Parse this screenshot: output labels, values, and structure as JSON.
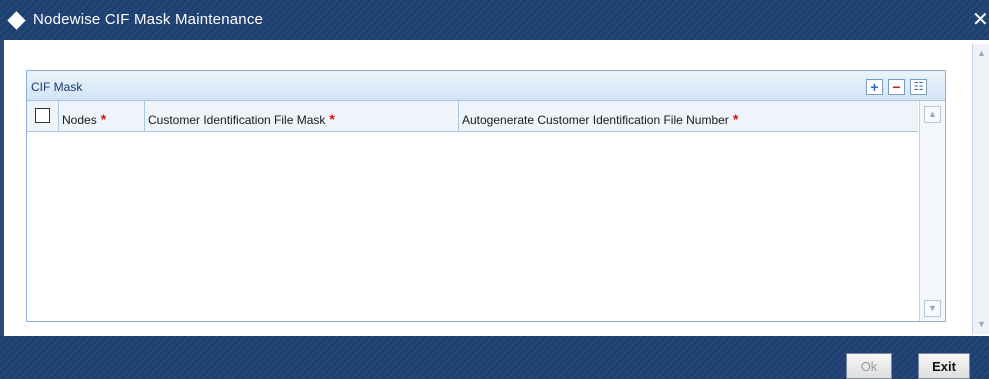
{
  "window": {
    "title": "Nodewise CIF Mask Maintenance",
    "close_glyph": "✕"
  },
  "panel": {
    "caption": "CIF Mask",
    "toolbar": {
      "add_glyph": "+",
      "delete_glyph": "−",
      "view_glyph": "☷"
    }
  },
  "grid": {
    "columns": [
      {
        "label": "Nodes",
        "required": true
      },
      {
        "label": "Customer Identification File Mask",
        "required": true
      },
      {
        "label": "Autogenerate Customer Identification File Number",
        "required": true
      }
    ],
    "required_marker": "*",
    "rows": []
  },
  "scroll": {
    "up_glyph": "▲",
    "down_glyph": "▼"
  },
  "footer": {
    "ok_label": "Ok",
    "exit_label": "Exit"
  },
  "colors": {
    "titlebar": "#1e3f70",
    "panel_border": "#8fb2d6",
    "required": "#e01010"
  }
}
